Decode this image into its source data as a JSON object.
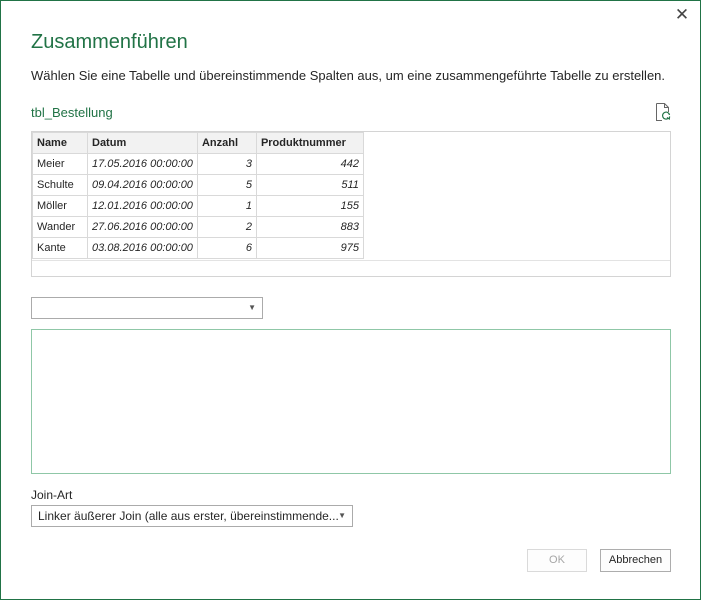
{
  "dialog": {
    "title": "Zusammenführen",
    "description": "Wählen Sie eine Tabelle und übereinstimmende Spalten aus, um eine zusammengeführte Tabelle zu erstellen.",
    "close_icon": "close-icon"
  },
  "first_table": {
    "name": "tbl_Bestellung",
    "refresh_icon": "refresh-icon",
    "columns": [
      "Name",
      "Datum",
      "Anzahl",
      "Produktnummer"
    ],
    "rows": [
      [
        "Meier",
        "17.05.2016 00:00:00",
        "3",
        "442"
      ],
      [
        "Schulte",
        "09.04.2016 00:00:00",
        "5",
        "511"
      ],
      [
        "Möller",
        "12.01.2016 00:00:00",
        "1",
        "155"
      ],
      [
        "Wander",
        "27.06.2016 00:00:00",
        "2",
        "883"
      ],
      [
        "Kante",
        "03.08.2016 00:00:00",
        "6",
        "975"
      ]
    ]
  },
  "second_table": {
    "selected": ""
  },
  "join": {
    "label": "Join-Art",
    "selected": "Linker äußerer Join (alle aus erster, übereinstimmende..."
  },
  "buttons": {
    "ok": "OK",
    "cancel": "Abbrechen"
  },
  "colors": {
    "accent": "#217346"
  }
}
